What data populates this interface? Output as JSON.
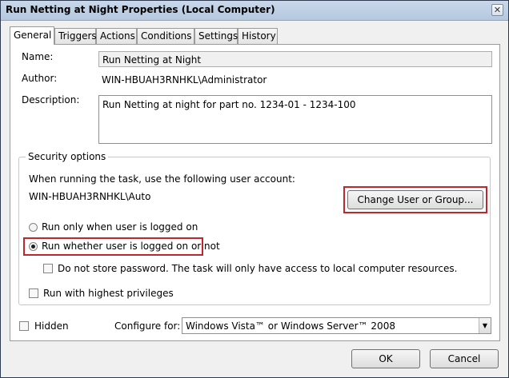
{
  "window": {
    "title": "Run Netting at Night Properties (Local Computer)",
    "close_glyph": "✕"
  },
  "tabs": [
    {
      "label": "General",
      "active": true
    },
    {
      "label": "Triggers",
      "active": false
    },
    {
      "label": "Actions",
      "active": false
    },
    {
      "label": "Conditions",
      "active": false
    },
    {
      "label": "Settings",
      "active": false
    },
    {
      "label": "History",
      "active": false
    }
  ],
  "general": {
    "name_label": "Name:",
    "name_value": "Run Netting at Night",
    "author_label": "Author:",
    "author_value": "WIN-HBUAH3RNHKL\\Administrator",
    "description_label": "Description:",
    "description_value": "Run Netting at night for part no. 1234-01 - 1234-100"
  },
  "security": {
    "legend": "Security options",
    "account_prompt": "When running the task, use the following user account:",
    "account_value": "WIN-HBUAH3RNHKL\\Auto",
    "change_button": "Change User or Group...",
    "radio_logged_on": "Run only when user is logged on",
    "radio_whether": "Run whether user is logged on or not",
    "selected_radio": "Run whether user is logged on or not",
    "no_store_password": "Do not store password.  The task will only have access to local computer resources.",
    "no_store_password_checked": false,
    "highest_privileges": "Run with highest privileges",
    "highest_privileges_checked": false
  },
  "bottom": {
    "hidden_label": "Hidden",
    "hidden_checked": false,
    "configure_label": "Configure for:",
    "configure_value": "Windows Vista™ or Windows Server™ 2008"
  },
  "buttons": {
    "ok": "OK",
    "cancel": "Cancel"
  },
  "colors": {
    "highlight": "#c0272d"
  }
}
